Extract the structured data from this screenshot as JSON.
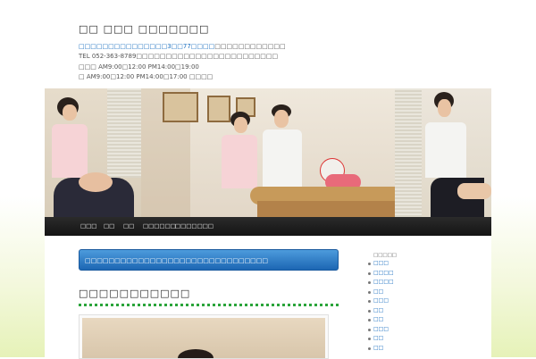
{
  "site": {
    "title": "□□ □□□ □□□□□□□",
    "address_link": "□□□□□□□□□□□□□□□3□□77□□□□",
    "address_rest": "□□□□□□□□□□□□",
    "tel": "TEL 052-363-8789□□□□□□□□□□□□□□□□□□□□□□□□",
    "hours_1": "□□□ AM9:00□12:00 PM14:00□19:00",
    "hours_2": "□ AM9:00□12:00 PM14:00□17:00 □□□□"
  },
  "nav": {
    "items": [
      {
        "label": "□□□"
      },
      {
        "label": "□□"
      },
      {
        "label": "□□"
      },
      {
        "label": "□□□□□□"
      },
      {
        "label": "□□□□□□□"
      }
    ]
  },
  "main": {
    "banner": "□□□□□□□□□□□□□□□□□□□□□□□□□□□□□□□",
    "post_title": "□□□□□□□□□□□"
  },
  "sidebar": {
    "title": "□□□□□",
    "items": [
      {
        "label": "□□□"
      },
      {
        "label": "□□□□"
      },
      {
        "label": "□□□□"
      },
      {
        "label": "□□"
      },
      {
        "label": "□□□"
      },
      {
        "label": "□□"
      },
      {
        "label": "□□"
      },
      {
        "label": "□□□"
      },
      {
        "label": "□□"
      },
      {
        "label": "□□"
      }
    ]
  },
  "colors": {
    "link": "#1a6fc0",
    "banner": "#1c66b3",
    "nav": "#1f1f1f",
    "divider": "#2aa43a"
  }
}
